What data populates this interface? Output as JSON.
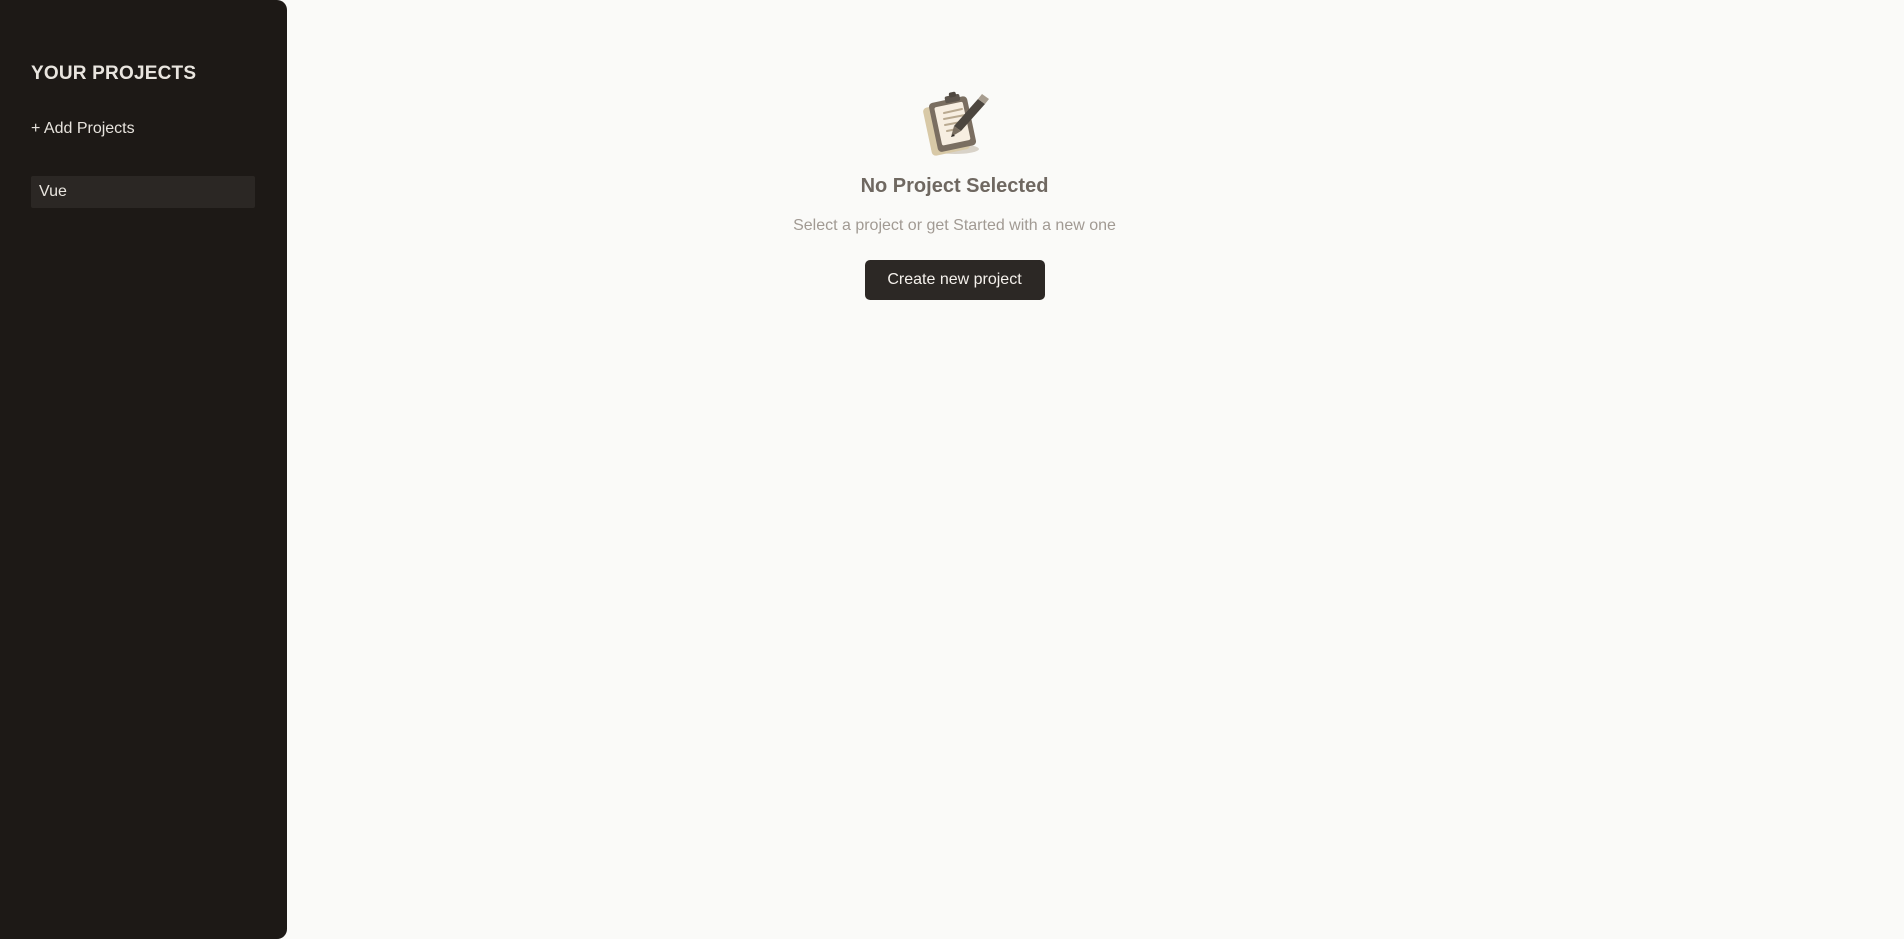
{
  "sidebar": {
    "title": "YOUR PROJECTS",
    "add_label": "+ Add Projects",
    "projects": [
      {
        "label": "Vue"
      }
    ]
  },
  "empty_state": {
    "icon": "clipboard-icon",
    "title": "No Project Selected",
    "subtitle": "Select a project or get Started with a new one",
    "button_label": "Create new project"
  },
  "colors": {
    "sidebar_bg": "#1d1916",
    "main_bg": "#fafaf8",
    "button_bg": "#2c2825",
    "selected_item_bg": "#2b2724"
  }
}
